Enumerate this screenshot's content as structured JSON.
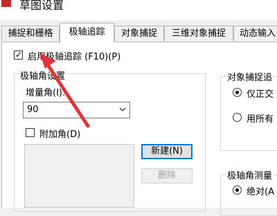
{
  "window": {
    "title": "草图设置"
  },
  "tabs": [
    {
      "label": "捕捉和栅格"
    },
    {
      "label": "极轴追踪"
    },
    {
      "label": "对象捕捉"
    },
    {
      "label": "三维对象捕捉"
    },
    {
      "label": "动态输入"
    }
  ],
  "polar_tracking": {
    "enable_label": "启用极轴追踪 (F10)(P)",
    "enabled": true
  },
  "angle_settings": {
    "group_title": "极轴角设置",
    "increment_label": "增量角(I):",
    "increment_value": "90",
    "additional_label": "附加角(D)",
    "additional_checked": false,
    "new_button": "新建(N)",
    "delete_button": "删除"
  },
  "object_snap": {
    "group_title": "对象捕捉追",
    "option1": "仅正交",
    "option2": "用所有",
    "selected": 1
  },
  "polar_measure": {
    "group_title": "极轴角测量",
    "option1": "绝对(A"
  },
  "colors": {
    "annotation_arrow": "#e0353b",
    "window_icon": "#c62828",
    "primary_border": "#0078d7"
  }
}
